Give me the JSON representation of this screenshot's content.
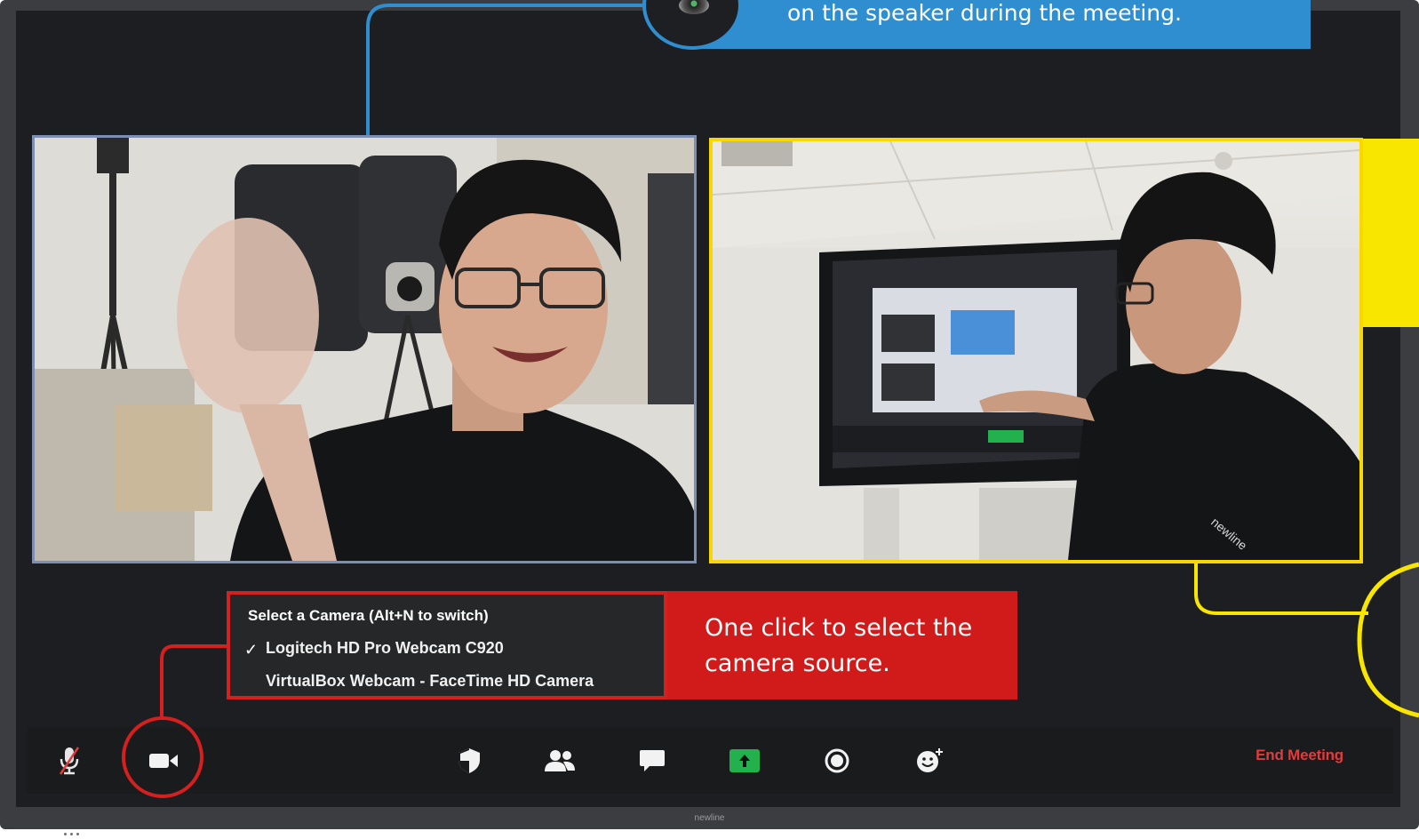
{
  "annotations": {
    "blue_callout_text": "on the speaker during the meeting.",
    "red_callout_text": "One click to select the camera source."
  },
  "camera_menu": {
    "header": "Select a Camera (Alt+N to switch)",
    "options": [
      {
        "label": "Logitech HD Pro Webcam C920",
        "selected": true
      },
      {
        "label": "VirtualBox Webcam - FaceTime HD Camera",
        "selected": false
      }
    ],
    "check_glyph": "✓"
  },
  "toolbar": {
    "buttons": [
      {
        "icon": "microphone-muted-icon"
      },
      {
        "icon": "video-camera-icon"
      },
      {
        "icon": "security-shield-icon"
      },
      {
        "icon": "participants-icon"
      },
      {
        "icon": "chat-icon"
      },
      {
        "icon": "share-screen-icon"
      },
      {
        "icon": "record-icon"
      },
      {
        "icon": "reactions-icon"
      }
    ],
    "end_meeting_label": "End Meeting"
  },
  "bezel": {
    "brand_text": "newline"
  },
  "colors": {
    "blue_accent": "#2f8ed0",
    "red_accent": "#d61f1f",
    "yellow_accent": "#f8d800",
    "end_meeting": "#e23b3b",
    "share_green": "#23b14d"
  }
}
